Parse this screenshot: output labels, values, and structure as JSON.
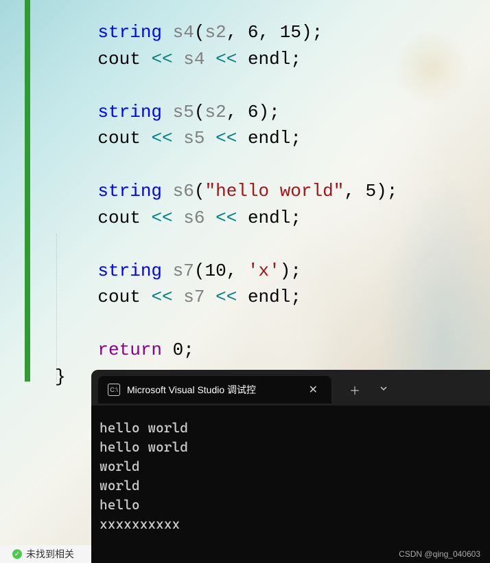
{
  "code": {
    "indent1": "    ",
    "s4_decl": {
      "type": "string",
      "name": "s4",
      "arg1": "s2",
      "arg2": "6",
      "arg3": "15"
    },
    "s4_cout": {
      "var": "s4"
    },
    "s5_decl": {
      "type": "string",
      "name": "s5",
      "arg1": "s2",
      "arg2": "6"
    },
    "s5_cout": {
      "var": "s5"
    },
    "s6_decl": {
      "type": "string",
      "name": "s6",
      "str": "\"hello world\"",
      "arg2": "5"
    },
    "s6_cout": {
      "var": "s6"
    },
    "s7_decl": {
      "type": "string",
      "name": "s7",
      "arg1": "10",
      "chr": "'x'"
    },
    "s7_cout": {
      "var": "s7"
    },
    "cout_kw": "cout",
    "endl_kw": "endl",
    "lshift": "<<",
    "return_kw": "return",
    "return_val": "0",
    "brace": "}"
  },
  "statusbar": {
    "text": "未找到相关"
  },
  "terminal": {
    "tab_title": "Microsoft Visual Studio 调试控",
    "output": {
      "line1": "hello world",
      "line2": "hello world",
      "line3": "world",
      "line4": "world",
      "line5": "hello",
      "line6": "xxxxxxxxxx"
    }
  },
  "watermark": "CSDN @qing_040603"
}
